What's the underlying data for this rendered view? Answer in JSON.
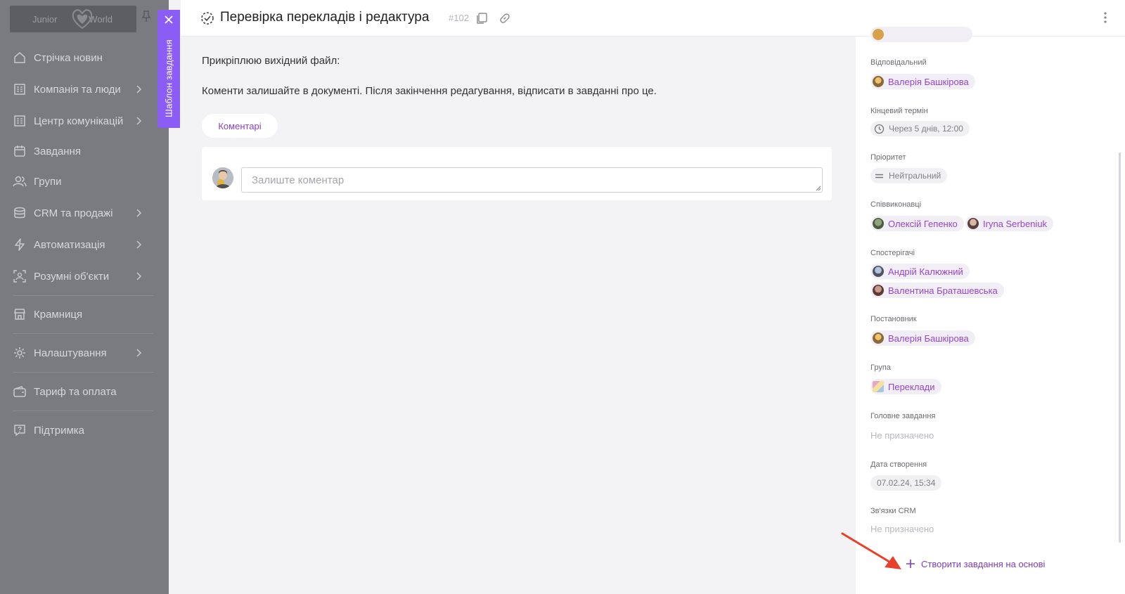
{
  "sidebar": {
    "logo_left": "Junior",
    "logo_right": "World",
    "items": [
      {
        "label": "Стрічка новин",
        "icon": "home-icon"
      },
      {
        "label": "Компанія та люди",
        "icon": "building-icon",
        "chevron": true
      },
      {
        "label": "Центр комунікацій",
        "icon": "building-icon",
        "chevron": true
      },
      {
        "label": "Завдання",
        "icon": "calendar-icon"
      },
      {
        "label": "Групи",
        "icon": "users-icon"
      },
      {
        "label": "CRM та продажі",
        "icon": "database-icon",
        "chevron": true
      },
      {
        "label": "Автоматизація",
        "icon": "lightning-icon",
        "chevron": true
      },
      {
        "label": "Розумні об'єкти",
        "icon": "scan-icon",
        "chevron": true
      },
      {
        "label": "Крамниця",
        "icon": "store-icon"
      },
      {
        "label": "Налаштування",
        "icon": "gear-icon",
        "chevron": true
      },
      {
        "label": "Тариф та оплата",
        "icon": "wallet-icon"
      },
      {
        "label": "Підтримка",
        "icon": "help-icon"
      }
    ]
  },
  "template_tab": {
    "label": "Шаблон завдання"
  },
  "header": {
    "title": "Перевірка перекладів і редактура",
    "number": "#102"
  },
  "description": {
    "line1": "Прикріплюю вихідний файл:",
    "line2": "Коменти залишайте в документі. Після закінчення редагування, відписати в завданні про це."
  },
  "comments": {
    "tab_label": "Коментарі",
    "placeholder": "Залиште коментар"
  },
  "properties": {
    "responsible_label": "Відповідальний",
    "responsible": "Валерія Башкірова",
    "deadline_label": "Кінцевий термін",
    "deadline": "Через 5 днів, 12:00",
    "priority_label": "Пріоритет",
    "priority": "Нейтральний",
    "coexecutors_label": "Співвиконавці",
    "coexecutors": [
      "Олексій Гепенко",
      "Iryna Serbeniuk"
    ],
    "observers_label": "Спостерігачі",
    "observers": [
      "Андрій Калюжний",
      "Валентина Браташевська"
    ],
    "author_label": "Постановник",
    "author": "Валерія Башкірова",
    "group_label": "Група",
    "group": "Переклади",
    "parent_label": "Головне завдання",
    "parent": "Не призначено",
    "created_label": "Дата створення",
    "created": "07.02.24, 15:34",
    "crm_label": "Зв'язки CRM",
    "crm": "Не призначено"
  },
  "create_button": {
    "label": "Створити завдання на основі"
  },
  "colors": {
    "accent": "#8c5cf6",
    "link": "#9646c9",
    "annotation_arrow": "#e8402d"
  }
}
